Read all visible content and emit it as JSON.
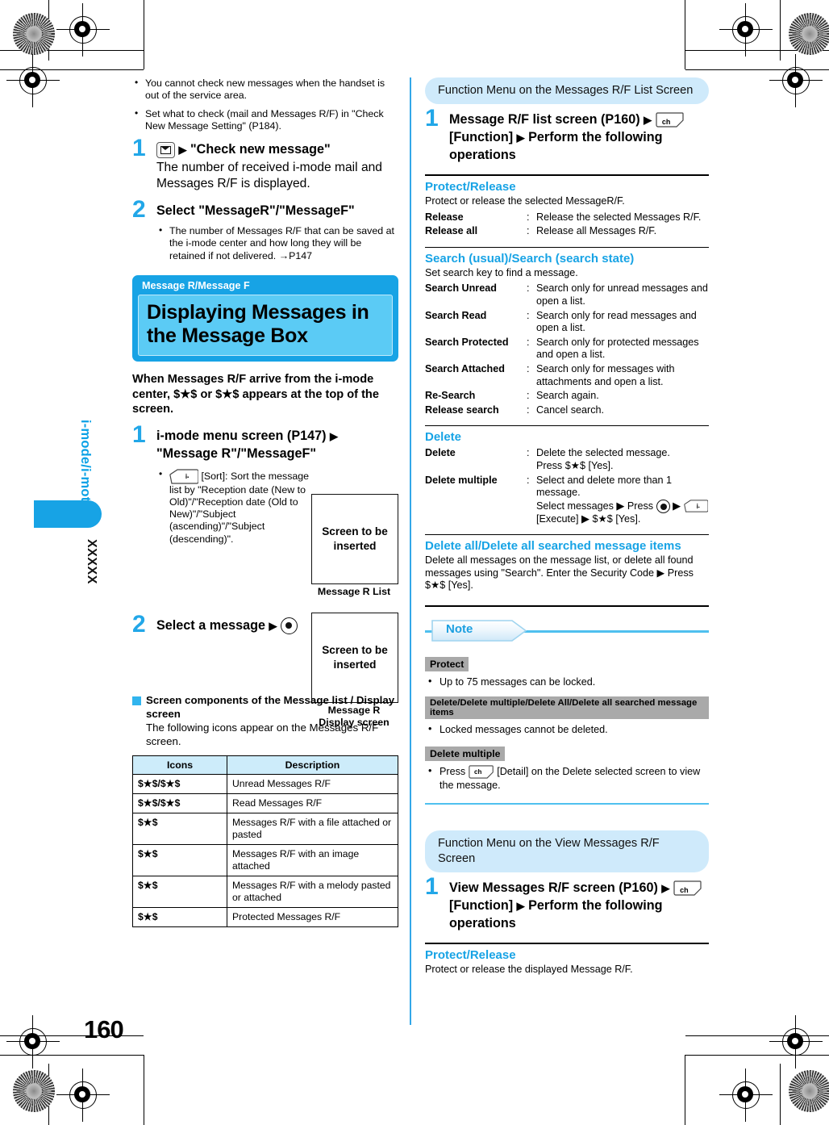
{
  "page": {
    "number": "160",
    "side_tab_label": "i-mode/i-motion",
    "side_tab_code": "XXXXX"
  },
  "left": {
    "intro_bullets": [
      "You cannot check new messages when the handset is out of the service area.",
      "Set what to check (mail and Messages R/F) in \"Check New Message Setting\" (P184)."
    ],
    "step1": {
      "num": "1",
      "key_icon": "mail-key-icon",
      "arrow": "▶",
      "heading": "\"Check new message\"",
      "body": "The number of received i-mode mail and Messages R/F is displayed."
    },
    "step2": {
      "num": "2",
      "heading": "Select \"MessageR\"/\"MessageF\"",
      "bullets": [
        "The number of Messages R/F that can be saved at the i-mode center and how long they will be retained if not delivered. →P147"
      ]
    },
    "section": {
      "caption": "Message R/Message F",
      "title": "Displaying Messages in the Message Box"
    },
    "lead": "When Messages R/F arrive from the i-mode center, $★$ or $★$ appears at the top of the screen.",
    "step3": {
      "num": "1",
      "heading_a": "i-mode menu screen (P147)",
      "arrow": "▶",
      "heading_b": "\"Message R\"/\"MessageF\"",
      "bullets": [
        "[Sort]: Sort the message list by \"Reception date (New to Old)\"/\"Reception date (Old to New)\"/\"Subject (ascending)\"/\"Subject (descending)\"."
      ]
    },
    "step4": {
      "num": "2",
      "heading": "Select a message",
      "arrow": "▶"
    },
    "shot1": {
      "text": "Screen to be inserted",
      "caption": "Message R List"
    },
    "shot2": {
      "text": "Screen to be inserted",
      "caption": "Message R Display screen"
    },
    "components": {
      "heading": "Screen components of the Message list / Display screen",
      "body": "The following icons appear on the Messages R/F screen.",
      "table": {
        "headers": [
          "Icons",
          "Description"
        ],
        "rows": [
          [
            "$★$/$★$",
            "Unread Messages R/F"
          ],
          [
            "$★$/$★$",
            "Read Messages R/F"
          ],
          [
            "$★$",
            "Messages R/F with a file attached or pasted"
          ],
          [
            "$★$",
            "Messages R/F with an image attached"
          ],
          [
            "$★$",
            "Messages R/F with a melody pasted or attached"
          ],
          [
            "$★$",
            "Protected Messages R/F"
          ]
        ]
      }
    }
  },
  "right": {
    "fnmenu1": {
      "banner": "Function Menu on the Messages R/F List Screen",
      "step_num": "1",
      "heading_a": "Message R/F list screen (P160)",
      "arrow": "▶",
      "key_icon": "ch-key-icon",
      "heading_b": "[Function]",
      "heading_c": "Perform the following operations"
    },
    "protect_release": {
      "title": "Protect/Release",
      "desc": "Protect or release the selected MessageR/F.",
      "items": [
        {
          "term": "Release",
          "def": "Release the selected Messages R/F."
        },
        {
          "term": "Release all",
          "def": "Release all Messages R/F."
        }
      ]
    },
    "search": {
      "title": "Search (usual)/Search (search state)",
      "desc": "Set search key to find a message.",
      "items": [
        {
          "term": "Search Unread",
          "def": "Search only for unread messages and open a list."
        },
        {
          "term": "Search Read",
          "def": "Search only for read messages and open a list."
        },
        {
          "term": "Search Protected",
          "def": "Search only for protected messages and open a list."
        },
        {
          "term": "Search Attached",
          "def": "Search only for messages with attachments and open a list."
        },
        {
          "term": "Re-Search",
          "def": "Search again."
        },
        {
          "term": "Release search",
          "def": "Cancel search."
        }
      ]
    },
    "delete": {
      "title": "Delete",
      "items": [
        {
          "term": "Delete",
          "def": "Delete the selected message.\nPress $★$ [Yes]."
        },
        {
          "term": "Delete multiple",
          "def": "Select and delete more than 1 message."
        }
      ],
      "multi_line2_a": "Select messages",
      "multi_line2_b": "Press",
      "multi_line3": "[Execute]",
      "multi_line3_b": "$★$ [Yes]."
    },
    "delete_all": {
      "title": "Delete all/Delete all searched message items",
      "desc": "Delete all messages on the message list, or delete all found messages using \"Search\". Enter the Security Code ▶ Press $★$ [Yes]."
    },
    "note": {
      "banner": "Note",
      "groups": [
        {
          "label": "Protect",
          "bullets": [
            "Up to 75 messages can be locked."
          ]
        },
        {
          "label": "Delete/Delete multiple/Delete All/Delete all searched message items",
          "bullets": [
            "Locked messages cannot be deleted."
          ]
        },
        {
          "label": "Delete multiple",
          "bullets": [
            "Press  [Detail] on the Delete selected screen to view the message."
          ]
        }
      ]
    },
    "fnmenu2": {
      "banner": "Function Menu on the View Messages R/F Screen",
      "step_num": "1",
      "heading_a": "View Messages R/F screen (P160)",
      "arrow": "▶",
      "heading_b": "[Function]",
      "heading_c": "Perform the following operations"
    },
    "protect_release2": {
      "title": "Protect/Release",
      "desc": "Protect or release the displayed Message R/F."
    }
  },
  "colors": {
    "accent_blue": "#17a3e5",
    "light_blue": "#5bcbf5",
    "banner_blue": "#cfeafb",
    "table_header": "#cdecfa",
    "gray_label": "#a9a9a9"
  }
}
